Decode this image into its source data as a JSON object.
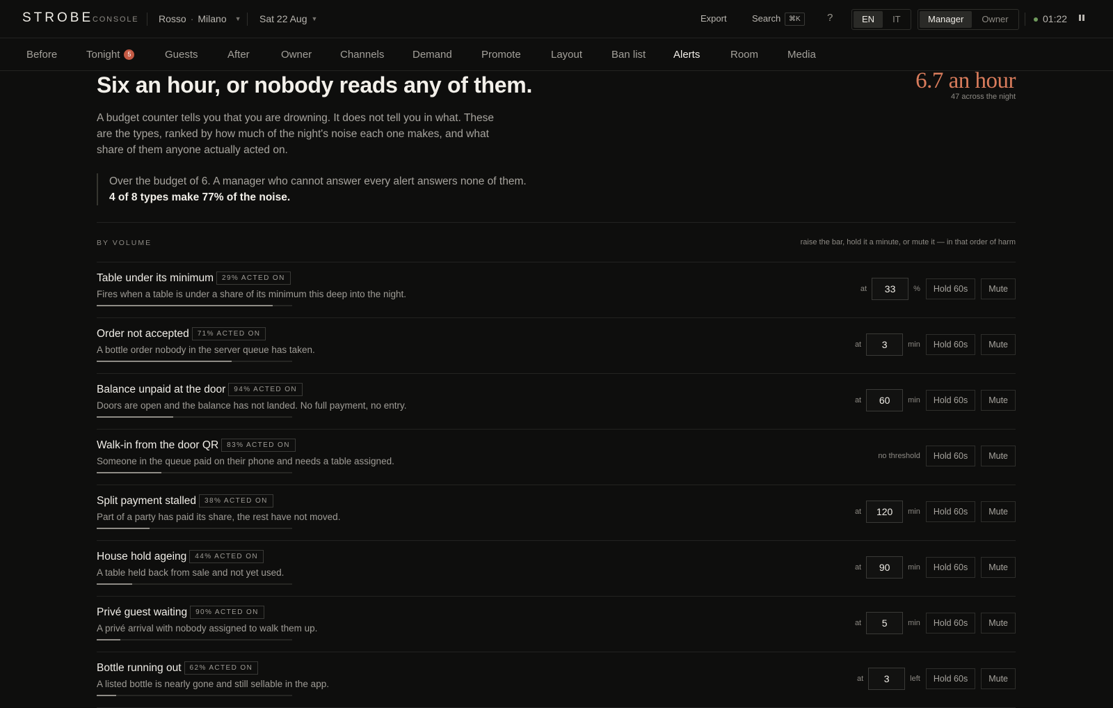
{
  "topbar": {
    "brand": "STROBE",
    "brand_sub": "CONSOLE",
    "venue_name": "Rosso",
    "venue_sep": "·",
    "venue_city": "Milano",
    "date": "Sat 22 Aug",
    "export_label": "Export",
    "search_label": "Search",
    "search_shortcut": "⌘K",
    "help": "?",
    "lang_options": [
      "EN",
      "IT"
    ],
    "lang_selected": "EN",
    "role_options": [
      "Manager",
      "Owner"
    ],
    "role_selected": "Manager",
    "clock": "01:22",
    "live_color": "#6f9a5d"
  },
  "nav": {
    "items": [
      {
        "label": "Before"
      },
      {
        "label": "Tonight",
        "badge": "5"
      },
      {
        "label": "Guests"
      },
      {
        "label": "After"
      },
      {
        "label": "Owner"
      },
      {
        "label": "Channels"
      },
      {
        "label": "Demand"
      },
      {
        "label": "Promote"
      },
      {
        "label": "Layout"
      },
      {
        "label": "Ban list"
      },
      {
        "label": "Alerts",
        "active": true
      },
      {
        "label": "Room"
      },
      {
        "label": "Media"
      }
    ]
  },
  "page": {
    "title": "Six an hour, or nobody reads any of them.",
    "rate": "6.7 an hour",
    "rate_sub": "47 across the night",
    "lede": "A budget counter tells you that you are drowning. It does not tell you in what. These are the types, ranked by how much of the night's noise each one makes, and what share of them anyone actually acted on.",
    "callout_text": "Over the budget of 6. A manager who cannot answer every alert answers none of them.",
    "callout_bold": "4 of 8 types make 77% of the noise.",
    "accent_color": "#d97c5c"
  },
  "section": {
    "label": "BY VOLUME",
    "hint": "raise the bar, hold it a minute, or mute it — in that order of harm",
    "at_label": "at",
    "hold_label": "Hold 60s",
    "mute_label": "Mute",
    "no_threshold_label": "no threshold"
  },
  "alerts": [
    {
      "title": "Table under its minimum",
      "acted": "29% ACTED ON",
      "desc": "Fires when a table is under a share of its minimum this deep into the night.",
      "volume_share": 0.9,
      "threshold": "33",
      "unit": "%"
    },
    {
      "title": "Order not accepted",
      "acted": "71% ACTED ON",
      "desc": "A bottle order nobody in the server queue has taken.",
      "volume_share": 0.69,
      "threshold": "3",
      "unit": "min"
    },
    {
      "title": "Balance unpaid at the door",
      "acted": "94% ACTED ON",
      "desc": "Doors are open and the balance has not landed. No full payment, no entry.",
      "volume_share": 0.39,
      "threshold": "60",
      "unit": "min"
    },
    {
      "title": "Walk-in from the door QR",
      "acted": "83% ACTED ON",
      "desc": "Someone in the queue paid on their phone and needs a table assigned.",
      "volume_share": 0.33,
      "threshold": null,
      "unit": null
    },
    {
      "title": "Split payment stalled",
      "acted": "38% ACTED ON",
      "desc": "Part of a party has paid its share, the rest have not moved.",
      "volume_share": 0.27,
      "threshold": "120",
      "unit": "min"
    },
    {
      "title": "House hold ageing",
      "acted": "44% ACTED ON",
      "desc": "A table held back from sale and not yet used.",
      "volume_share": 0.18,
      "threshold": "90",
      "unit": "min"
    },
    {
      "title": "Privé guest waiting",
      "acted": "90% ACTED ON",
      "desc": "A privé arrival with nobody assigned to walk them up.",
      "volume_share": 0.12,
      "threshold": "5",
      "unit": "min"
    },
    {
      "title": "Bottle running out",
      "acted": "62% ACTED ON",
      "desc": "A listed bottle is nearly gone and still sellable in the app.",
      "volume_share": 0.1,
      "threshold": "3",
      "unit": "left"
    }
  ]
}
